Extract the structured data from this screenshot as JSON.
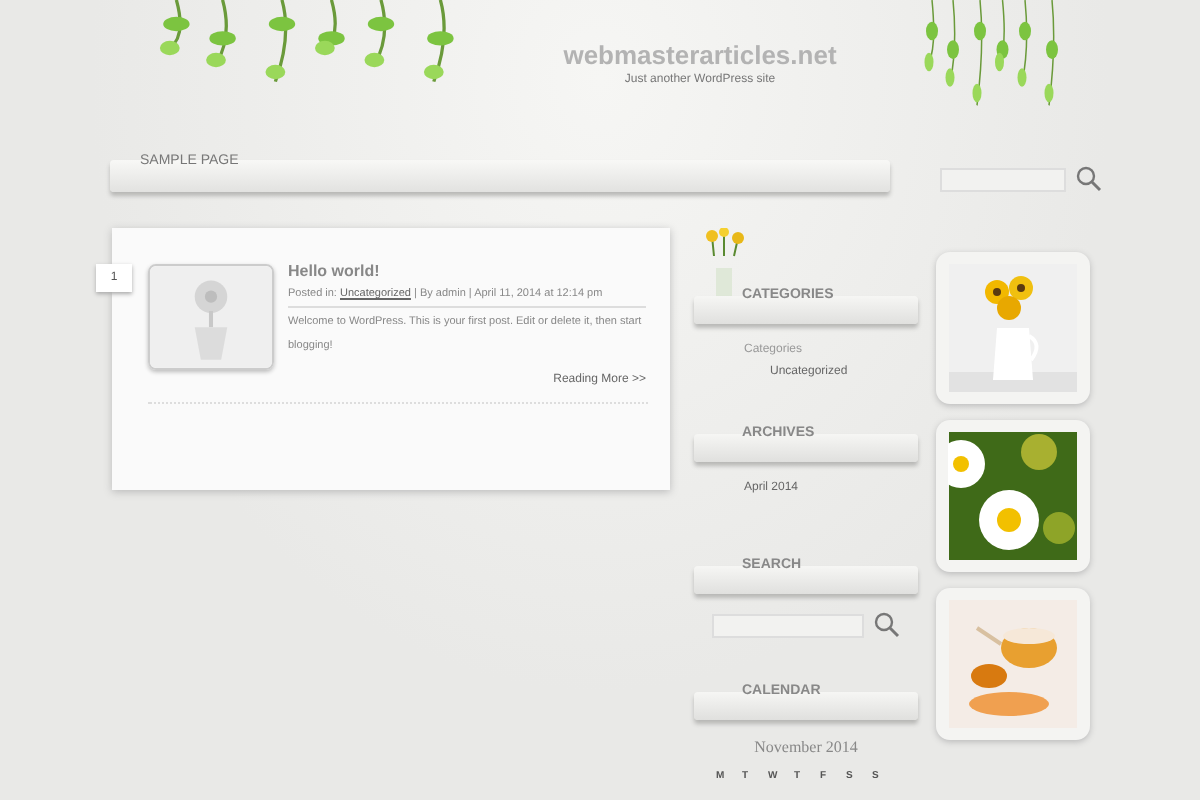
{
  "site": {
    "title": "webmasterarticles.net",
    "tagline": "Just another WordPress site"
  },
  "nav": {
    "items": [
      {
        "label": "SAMPLE PAGE"
      }
    ]
  },
  "posts": [
    {
      "number": "1",
      "title": "Hello world!",
      "posted_in": "Posted in:",
      "category": "Uncategorized",
      "by": "| By admin",
      "date": "| April 11, 2014 at 12:14 pm",
      "excerpt": "Welcome to WordPress. This is your first post. Edit or delete it, then start blogging!",
      "more": "Reading More >>"
    }
  ],
  "sidebar": {
    "widgets": [
      {
        "kind": "categories",
        "title": "CATEGORIES",
        "heading": "Categories",
        "items": [
          "Uncategorized"
        ]
      },
      {
        "kind": "archives",
        "title": "ARCHIVES",
        "items": [
          "April 2014"
        ]
      },
      {
        "kind": "search",
        "title": "SEARCH"
      },
      {
        "kind": "calendar",
        "title": "CALENDAR",
        "month": "November 2014",
        "weekdays": [
          "M",
          "T",
          "W",
          "T",
          "F",
          "S",
          "S"
        ]
      }
    ]
  },
  "photos": [
    {
      "kind": "sunflowers"
    },
    {
      "kind": "daisy"
    },
    {
      "kind": "teapot"
    }
  ]
}
